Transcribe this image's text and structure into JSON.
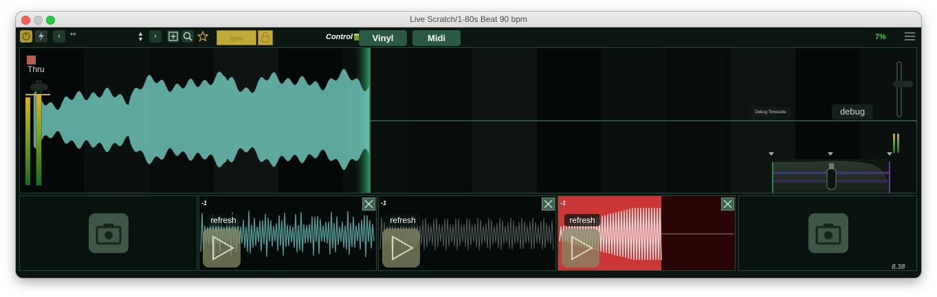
{
  "window": {
    "title": "Live Scratch/1-80s Beat 90 bpm"
  },
  "toolbar": {
    "prev_label": "‹",
    "rate_text": "**",
    "next_label": "›",
    "sync_label": "Sync",
    "control_label": "Control",
    "control_tabs": [
      {
        "label": "Vinyl"
      },
      {
        "label": "Midi"
      }
    ],
    "percent": "7%"
  },
  "deck": {
    "thru_label": "Thru",
    "debug_timecode_label": "Debug Timecode",
    "debug_label": "debug",
    "progress": 0.39
  },
  "samples": [
    {
      "number": "-1",
      "refresh_label": "refresh",
      "color": "#5fa7a6",
      "filled": true
    },
    {
      "number": "-1",
      "refresh_label": "refresh",
      "color": "#8a9aa0",
      "filled": false
    },
    {
      "number": "-1",
      "refresh_label": "refresh",
      "color": "#e84040",
      "filled": false
    }
  ],
  "status": {
    "time": "8.38"
  },
  "colors": {
    "accent": "#2a5a44",
    "waveform": "#6fc3b8",
    "gold": "#c2a93a",
    "level": "#48d448"
  }
}
